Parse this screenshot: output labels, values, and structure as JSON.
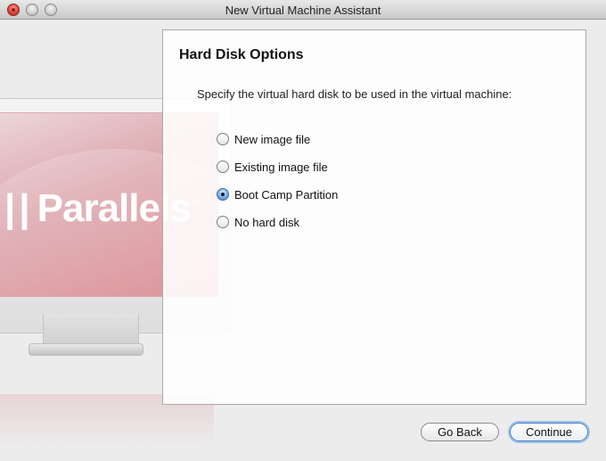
{
  "window": {
    "title": "New Virtual Machine Assistant"
  },
  "art": {
    "brand_bars": "||",
    "brand_text": "Parallels",
    "brand_tm": "™"
  },
  "page": {
    "heading": "Hard Disk Options",
    "instructions": "Specify the virtual hard disk to be used in the virtual machine:"
  },
  "options": [
    {
      "label": "New image file",
      "selected": false
    },
    {
      "label": "Existing image file",
      "selected": false
    },
    {
      "label": "Boot Camp Partition",
      "selected": true
    },
    {
      "label": "No hard disk",
      "selected": false
    }
  ],
  "buttons": {
    "back_label": "Go Back",
    "continue_label": "Continue"
  },
  "colors": {
    "accent": "#3e7ecb",
    "brand_pink": "#d47d85"
  }
}
